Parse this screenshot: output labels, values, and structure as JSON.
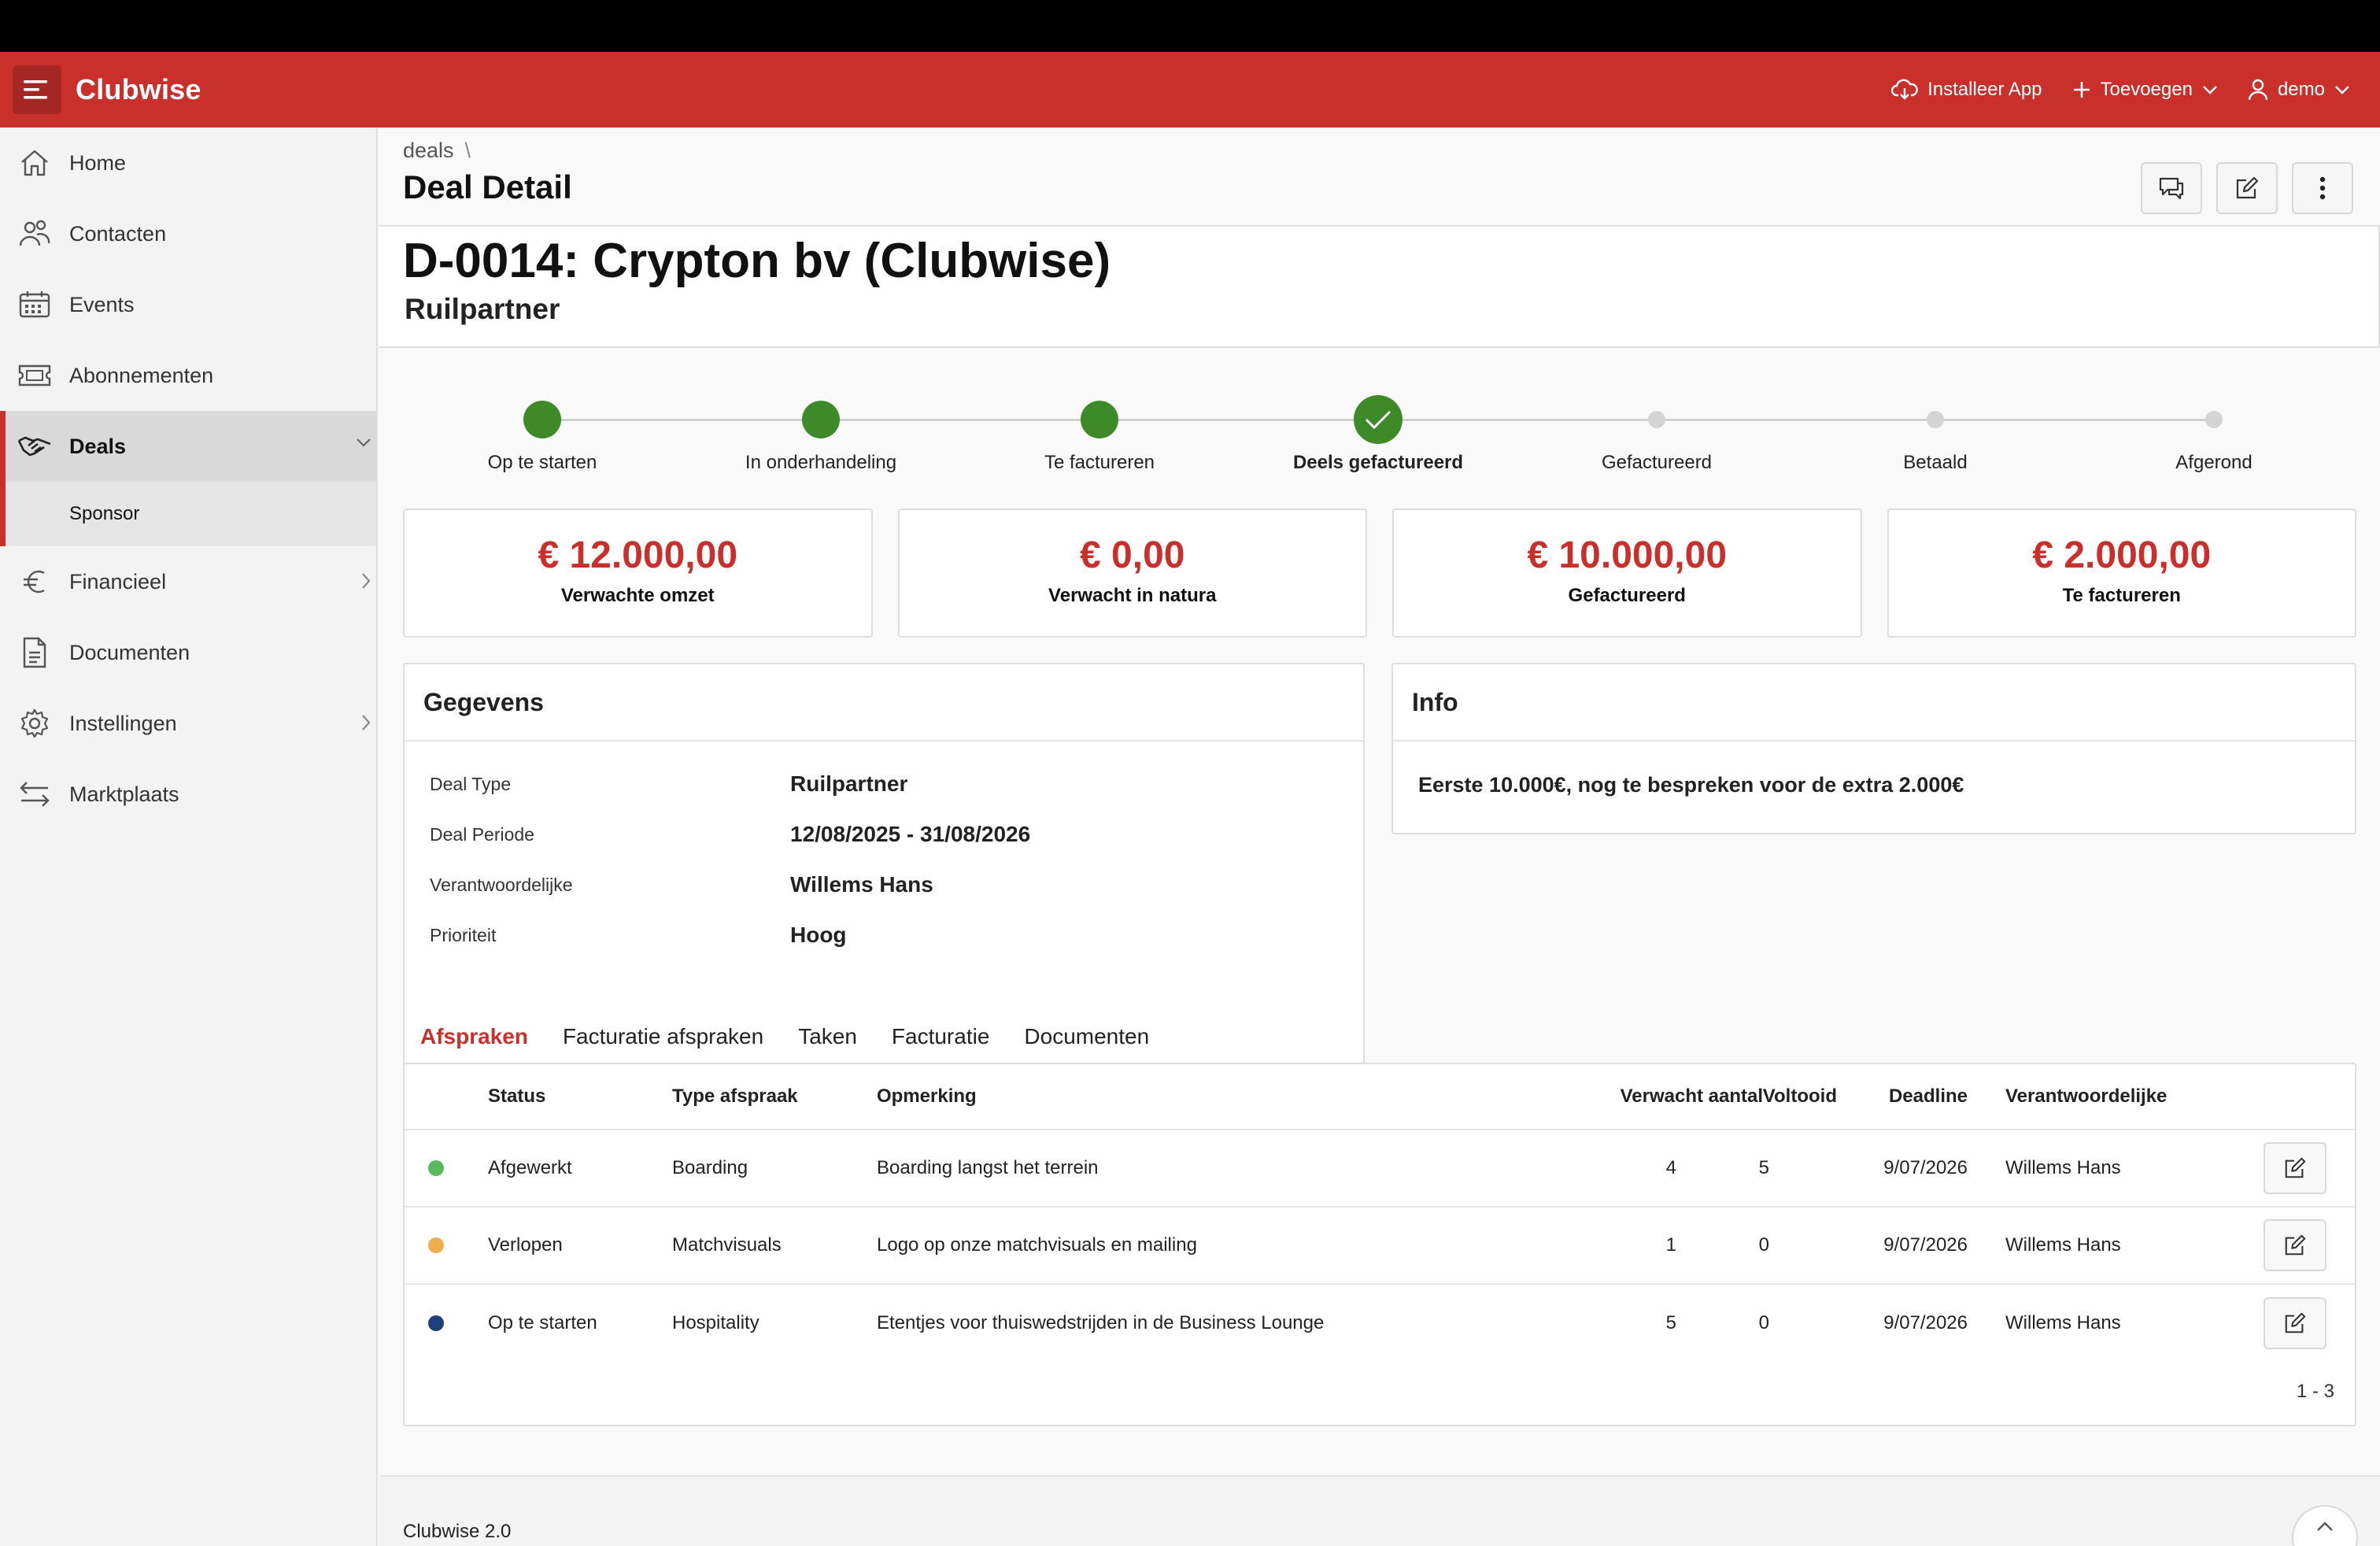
{
  "app": {
    "brand": "Clubwise",
    "header_actions": {
      "install": "Installeer App",
      "add": "Toevoegen",
      "user": "demo"
    }
  },
  "sidebar": {
    "items": [
      {
        "label": "Home",
        "icon": "home-icon"
      },
      {
        "label": "Contacten",
        "icon": "users-icon"
      },
      {
        "label": "Events",
        "icon": "calendar-icon"
      },
      {
        "label": "Abonnementen",
        "icon": "ticket-icon"
      },
      {
        "label": "Deals",
        "icon": "handshake-icon"
      },
      {
        "label": "Financieel",
        "icon": "euro-icon"
      },
      {
        "label": "Documenten",
        "icon": "document-icon"
      },
      {
        "label": "Instellingen",
        "icon": "gear-icon"
      },
      {
        "label": "Marktplaats",
        "icon": "arrows-icon"
      }
    ],
    "sub_item": "Sponsor"
  },
  "page": {
    "breadcrumb": "deals",
    "breadcrumb_sep": "\\",
    "title": "Deal Detail"
  },
  "deal": {
    "title": "D-0014: Crypton bv (Clubwise)",
    "subtitle": "Ruilpartner"
  },
  "progress": {
    "steps": [
      {
        "label": "Op te starten",
        "state": "done"
      },
      {
        "label": "In onderhandeling",
        "state": "done"
      },
      {
        "label": "Te factureren",
        "state": "done"
      },
      {
        "label": "Deels gefactureerd",
        "state": "current"
      },
      {
        "label": "Gefactureerd",
        "state": "todo"
      },
      {
        "label": "Betaald",
        "state": "todo"
      },
      {
        "label": "Afgerond",
        "state": "todo"
      }
    ]
  },
  "kpis": [
    {
      "value": "€ 12.000,00",
      "label": "Verwachte omzet"
    },
    {
      "value": "€ 0,00",
      "label": "Verwacht in natura"
    },
    {
      "value": "€ 10.000,00",
      "label": "Gefactureerd"
    },
    {
      "value": "€ 2.000,00",
      "label": "Te factureren"
    }
  ],
  "gegevens": {
    "title": "Gegevens",
    "rows": [
      {
        "label": "Deal Type",
        "value": "Ruilpartner"
      },
      {
        "label": "Deal Periode",
        "value": "12/08/2025 - 31/08/2026"
      },
      {
        "label": "Verantwoordelijke",
        "value": "Willems Hans"
      },
      {
        "label": "Prioriteit",
        "value": "Hoog"
      }
    ]
  },
  "info": {
    "title": "Info",
    "text": "Eerste 10.000€, nog te bespreken voor de extra 2.000€"
  },
  "tabs": [
    "Afspraken",
    "Facturatie afspraken",
    "Taken",
    "Facturatie",
    "Documenten"
  ],
  "table": {
    "headers": {
      "status": "Status",
      "type": "Type afspraak",
      "remark": "Opmerking",
      "expected": "Verwacht aantal",
      "done": "Voltooid",
      "deadline": "Deadline",
      "owner": "Verantwoordelijke"
    },
    "rows": [
      {
        "status": "Afgewerkt",
        "status_color": "#5cb85c",
        "type": "Boarding",
        "remark": "Boarding langst het terrein",
        "expected": "4",
        "done": "5",
        "deadline": "9/07/2026",
        "owner": "Willems Hans"
      },
      {
        "status": "Verlopen",
        "status_color": "#f0ad4e",
        "type": "Matchvisuals",
        "remark": "Logo op onze matchvisuals en mailing",
        "expected": "1",
        "done": "0",
        "deadline": "9/07/2026",
        "owner": "Willems Hans"
      },
      {
        "status": "Op te starten",
        "status_color": "#1f3f7a",
        "type": "Hospitality",
        "remark": "Etentjes voor thuiswedstrijden in de Business Lounge",
        "expected": "5",
        "done": "0",
        "deadline": "9/07/2026",
        "owner": "Willems Hans"
      }
    ],
    "pager": "1 - 3"
  },
  "footer": {
    "text": "Clubwise 2.0"
  },
  "colors": {
    "brand": "#c9302c",
    "progress_done": "#3f8a28"
  }
}
